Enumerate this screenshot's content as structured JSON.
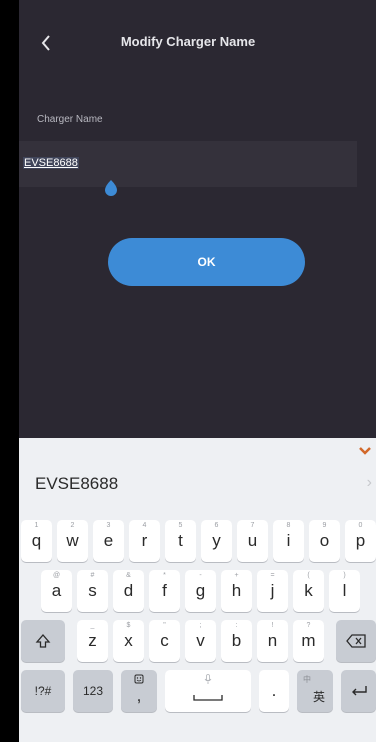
{
  "header": {
    "title": "Modify Charger Name",
    "back_icon": "chevron-left-icon"
  },
  "form": {
    "label": "Charger Name",
    "value": "EVSE8688"
  },
  "actions": {
    "ok_label": "OK"
  },
  "keyboard": {
    "suggestion": "EVSE8688",
    "row1": [
      "q",
      "w",
      "e",
      "r",
      "t",
      "y",
      "u",
      "i",
      "o",
      "p"
    ],
    "row1_hints": [
      "1",
      "2",
      "3",
      "4",
      "5",
      "6",
      "7",
      "8",
      "9",
      "0"
    ],
    "row2": [
      "a",
      "s",
      "d",
      "f",
      "g",
      "h",
      "j",
      "k",
      "l"
    ],
    "row2_hints": [
      "@",
      "#",
      "&",
      "*",
      "-",
      "+",
      "=",
      "(",
      ")"
    ],
    "row3": [
      "z",
      "x",
      "c",
      "v",
      "b",
      "n",
      "m"
    ],
    "row3_hints": [
      "_",
      "$",
      "\"",
      ";",
      ":",
      "!",
      "?"
    ],
    "symbols_label": "!?#",
    "numbers_label": "123",
    "comma": ",",
    "period": ".",
    "lang_label": "英",
    "lang_hint": "中",
    "colors": {
      "accent": "#3d8bd6",
      "app_bg": "#2b2832",
      "keyboard_bg": "#eef0f3"
    }
  }
}
